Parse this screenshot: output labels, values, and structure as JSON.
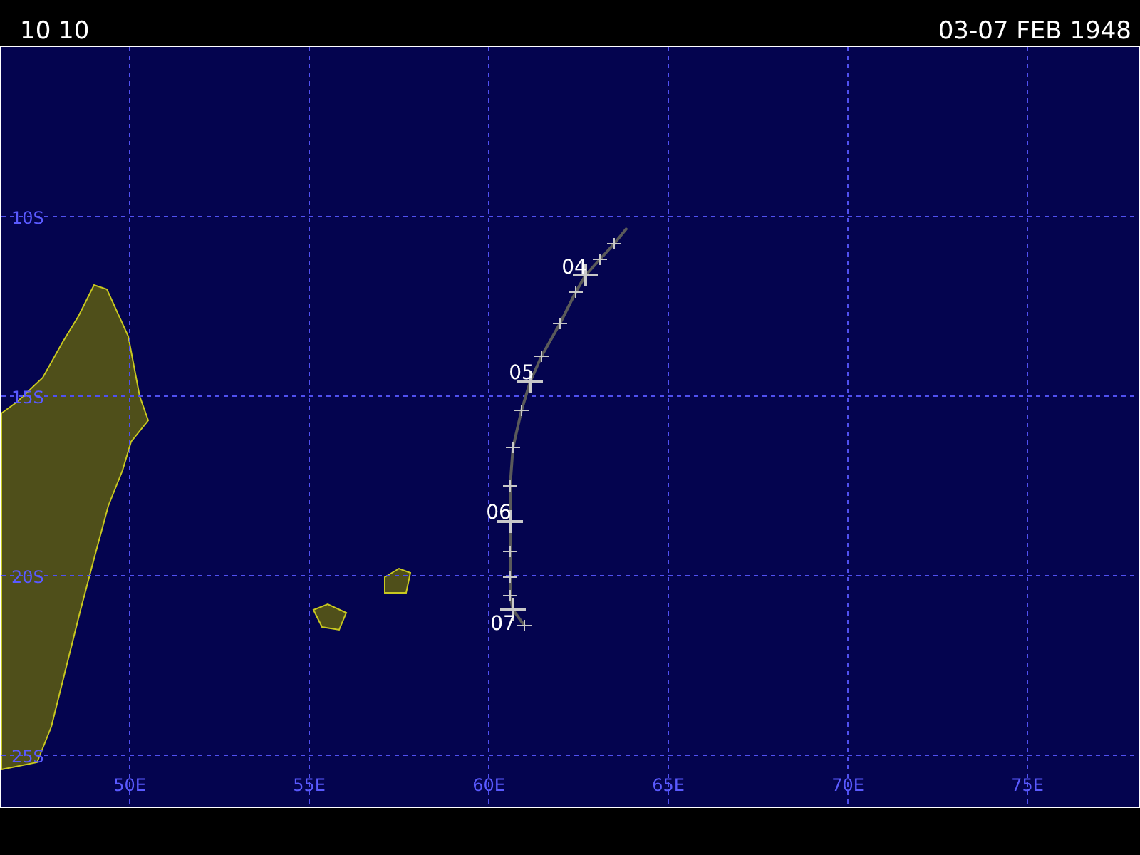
{
  "header": {
    "code": "10 10",
    "date_range": "03-07 FEB 1948"
  },
  "map": {
    "lat_labels": [
      "10S",
      "15S",
      "20S",
      "25S"
    ],
    "lon_labels": [
      "50E",
      "55E",
      "60E",
      "65E",
      "70E",
      "75E"
    ],
    "day_labels": [
      "04",
      "05",
      "06",
      "07"
    ]
  }
}
